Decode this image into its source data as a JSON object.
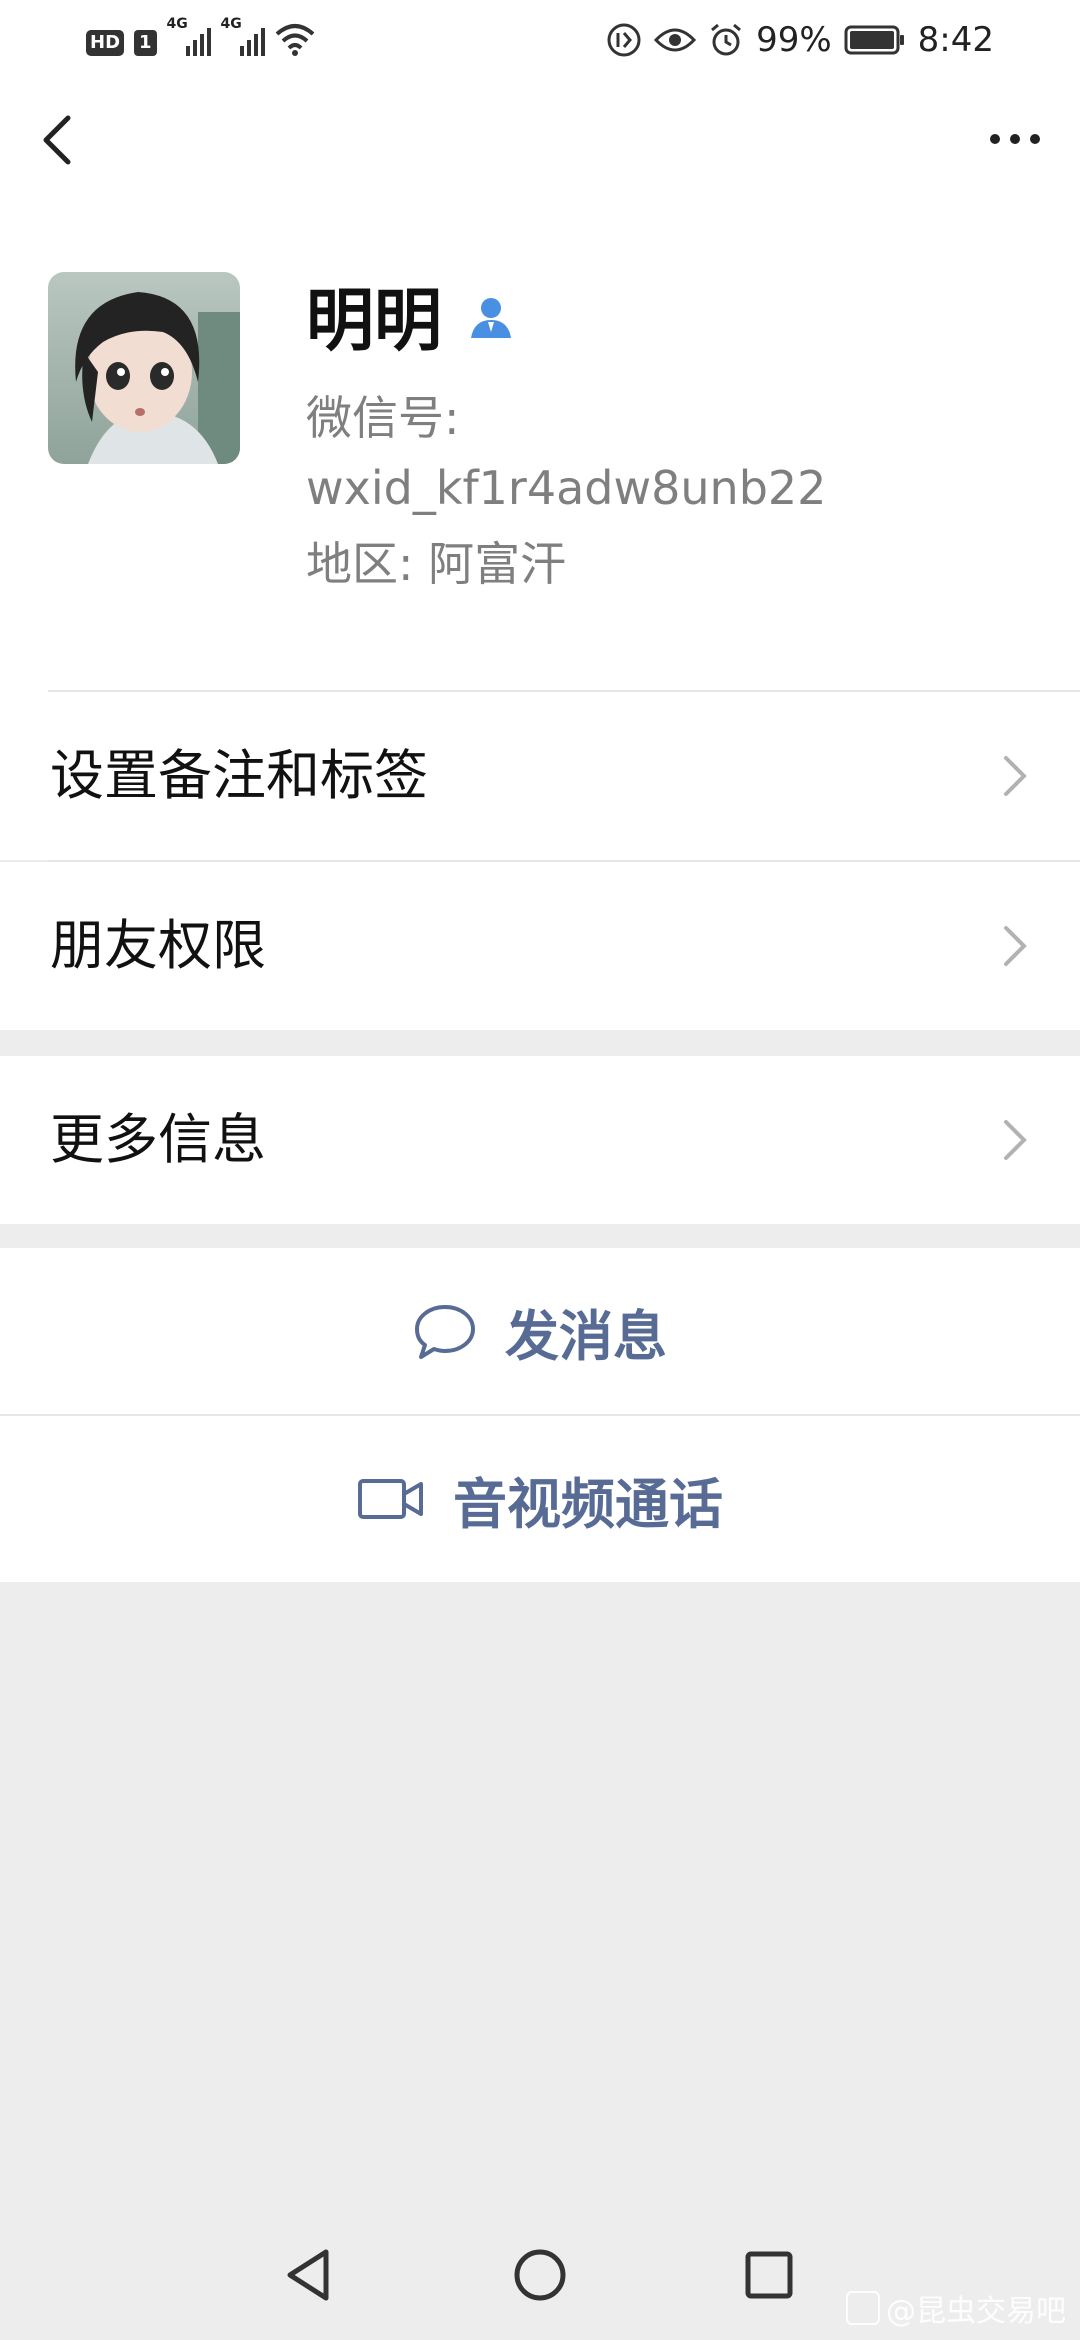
{
  "status_bar": {
    "hd": "HD",
    "sim": "1",
    "network1": "4G",
    "network2": "4G",
    "battery": "99%",
    "time": "8:42"
  },
  "header": {
    "back_icon": "chevron-left-icon",
    "more_icon": "more-dots-icon"
  },
  "profile": {
    "name": "明明",
    "wechat_id_label": "微信号:",
    "wechat_id": "wxid_kf1r4adw8unb22",
    "region": "地区:  阿富汗"
  },
  "menu": {
    "remark_tags": "设置备注和标签",
    "friend_permissions": "朋友权限",
    "more_info": "更多信息"
  },
  "actions": {
    "send_message": "发消息",
    "video_call": "音视频通话"
  },
  "watermark": "@昆虫交易吧",
  "colors": {
    "accent": "#576b95",
    "background": "#ededed",
    "badge_blue": "#4a90e2"
  }
}
